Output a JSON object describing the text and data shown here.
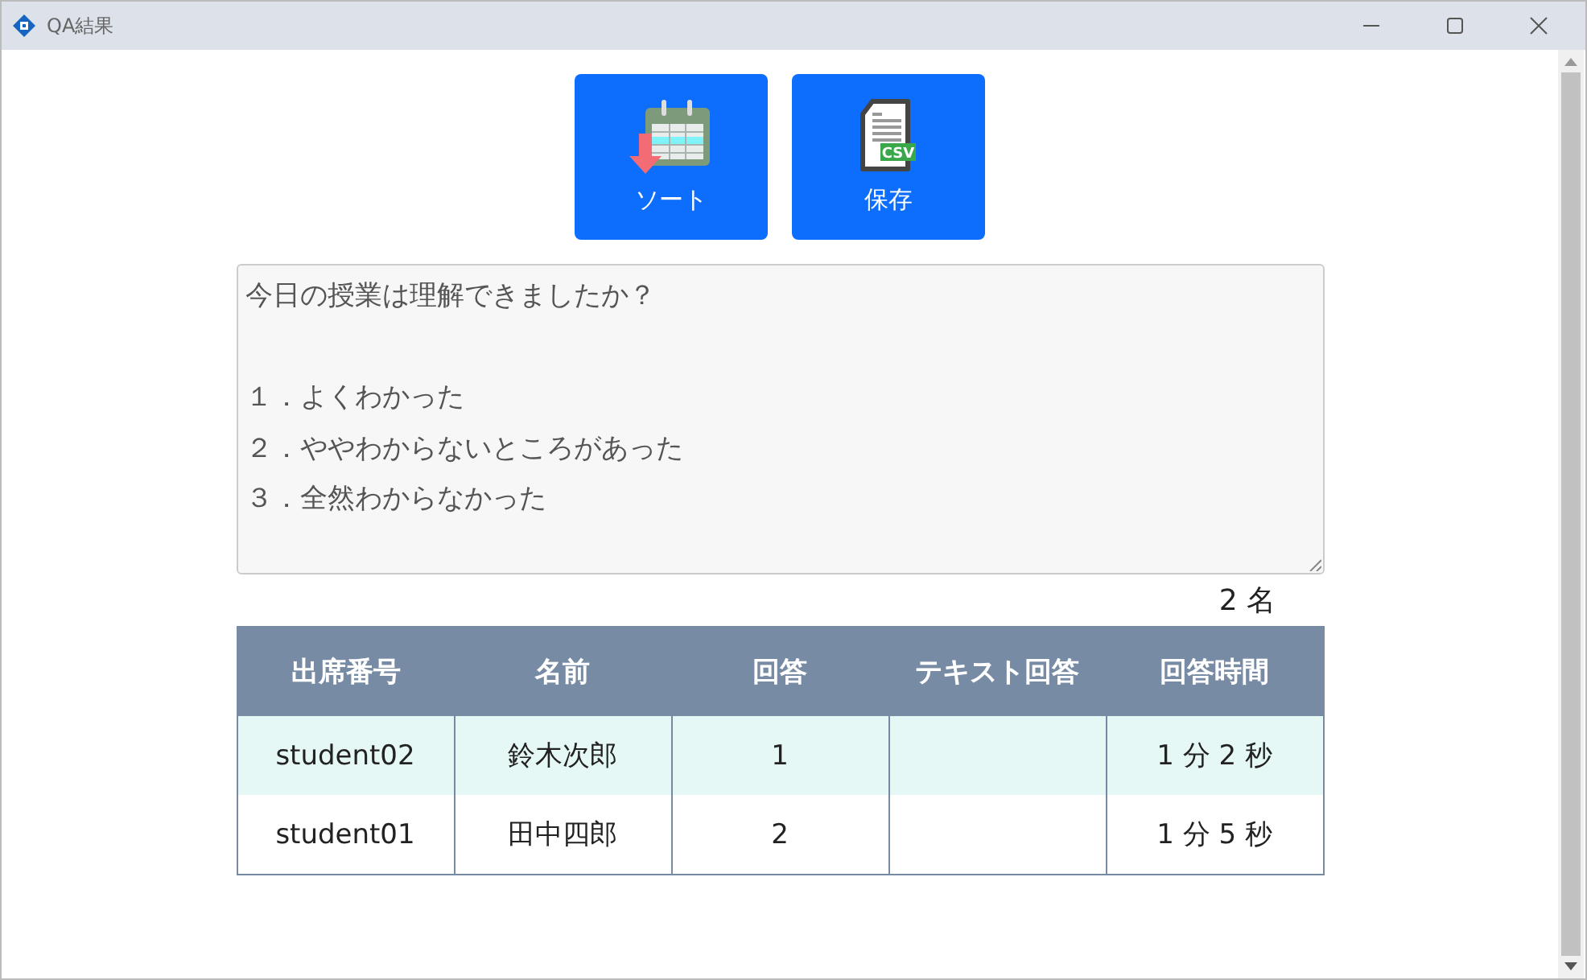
{
  "window": {
    "title": "QA結果"
  },
  "toolbar": [
    {
      "kind": "sort",
      "label": "ソート"
    },
    {
      "kind": "csv",
      "label": "保存",
      "icon_text": "CSV"
    }
  ],
  "question": {
    "title": "今日の授業は理解できましたか？",
    "options": [
      "１．よくわかった",
      "２．ややわからないところがあった",
      "３．全然わからなかった"
    ]
  },
  "count": "2 名",
  "table": {
    "columns": [
      "出席番号",
      "名前",
      "回答",
      "テキスト回答",
      "回答時間"
    ],
    "rows": [
      [
        "student02",
        "鈴木次郎",
        "1",
        "",
        "1 分 2 秒"
      ],
      [
        "student01",
        "田中四郎",
        "2",
        "",
        "1 分 5 秒"
      ]
    ]
  }
}
